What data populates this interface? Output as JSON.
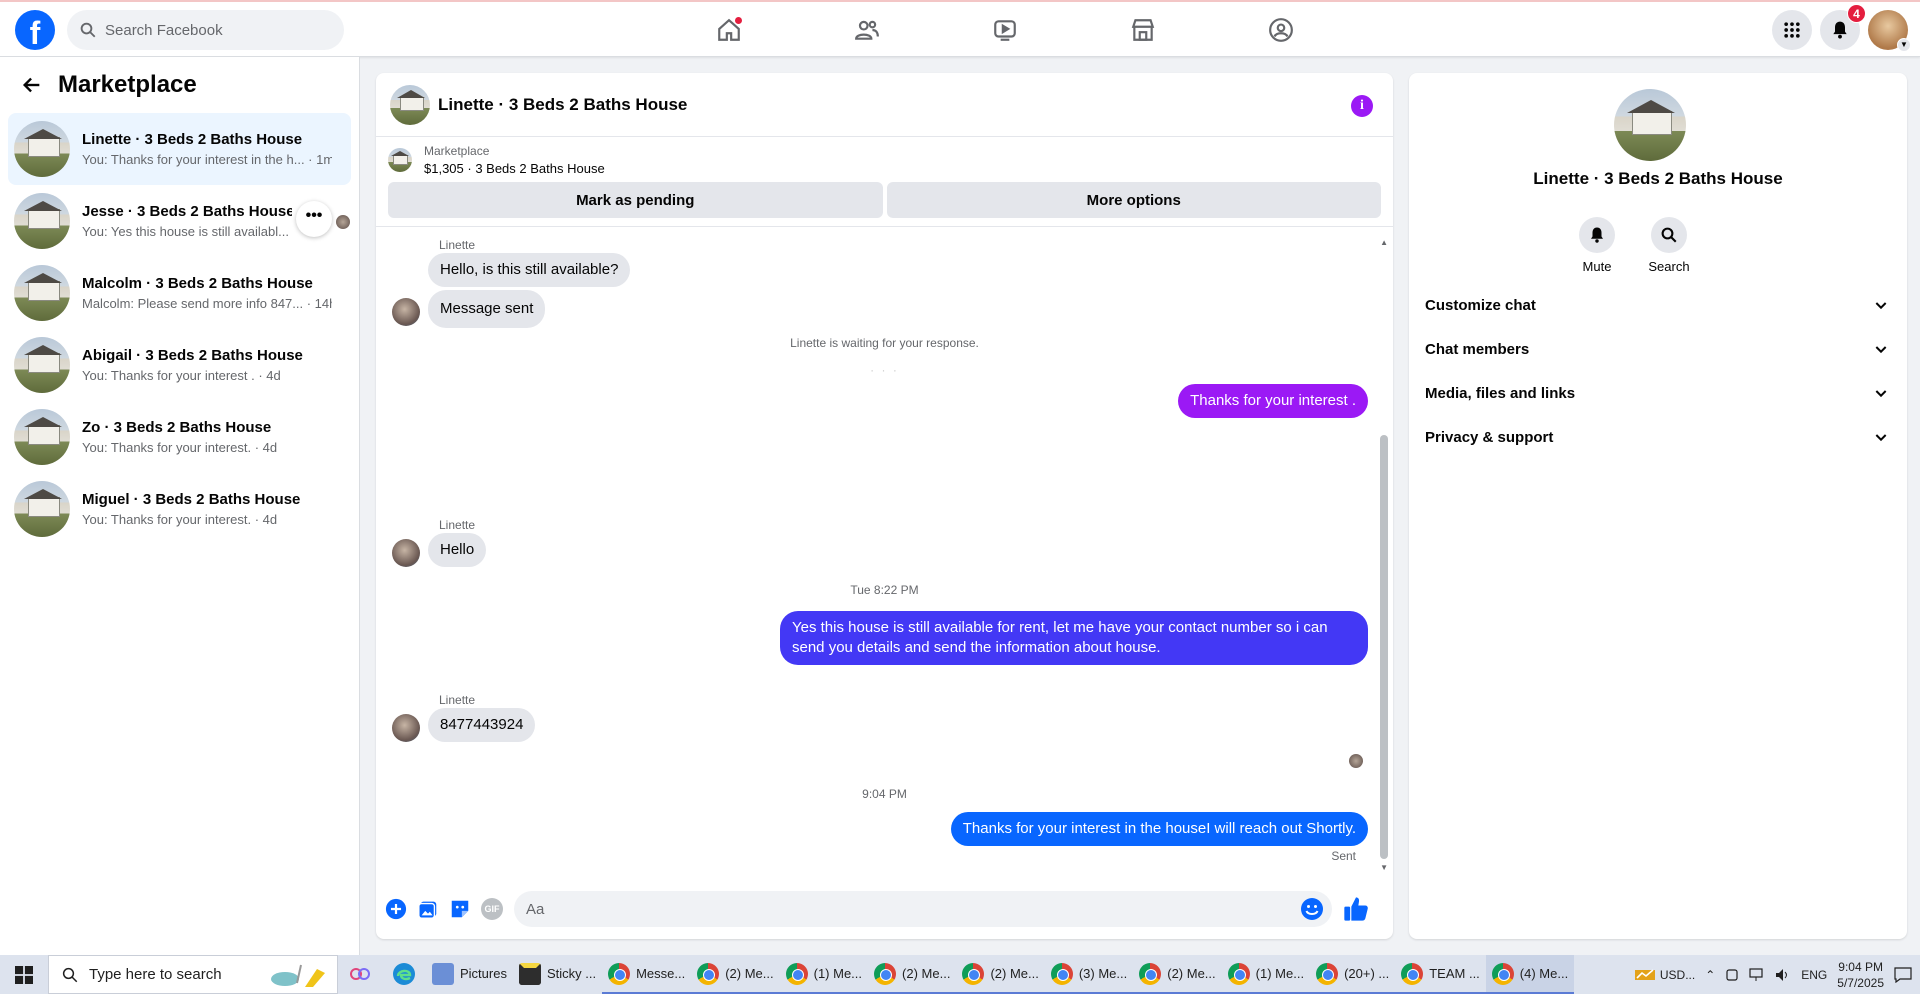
{
  "topbar": {
    "logo_letter": "f",
    "search_placeholder": "Search Facebook",
    "nav_icons": [
      "home-icon",
      "friends-icon",
      "video-icon",
      "marketplace-icon",
      "groups-icon"
    ],
    "notifications_badge": "4"
  },
  "sidebar": {
    "title": "Marketplace",
    "conversations": [
      {
        "name": "Linette · 3 Beds 2 Baths House",
        "preview": "You: Thanks for your interest in the h... · 1m",
        "active": true
      },
      {
        "name": "Jesse · 3 Beds 2 Baths House",
        "preview": "You: Yes this house is still availabl...",
        "active": false
      },
      {
        "name": "Malcolm · 3 Beds 2 Baths House",
        "preview": "Malcolm: Please send more info 847... · 14h",
        "active": false
      },
      {
        "name": "Abigail · 3 Beds 2 Baths House",
        "preview": "You: Thanks for your interest . · 4d",
        "active": false
      },
      {
        "name": "Zo · 3 Beds 2 Baths House",
        "preview": "You: Thanks for your interest. · 4d",
        "active": false
      },
      {
        "name": "Miguel · 3 Beds 2 Baths House",
        "preview": "You: Thanks for your interest. · 4d",
        "active": false
      }
    ],
    "more_button": "•••"
  },
  "chat": {
    "title": "Linette · 3 Beds 2 Baths House",
    "info_label": "i",
    "listing_label": "Marketplace",
    "listing_title": "$1,305 · 3 Beds 2 Baths House",
    "mark_pending": "Mark as pending",
    "more_options": "More options",
    "messages": {
      "sender1": "Linette",
      "m1": "Hello, is this still available?",
      "m2": "Message sent",
      "system": "Linette is waiting for your response.",
      "m3": "Thanks for your interest .",
      "sender2": "Linette",
      "m4": "Hello",
      "ts1": "Tue 8:22 PM",
      "m5_line1": "Yes this house is still available for rent, let me have your contact number so i can",
      "m5_line2": "send you details and send the information about house.",
      "sender3": "Linette",
      "m6": "8477443924",
      "ts2": "9:04 PM",
      "m7": "Thanks for your interest in the houseI will reach out Shortly.",
      "sent": "Sent"
    },
    "composer_placeholder": "Aa",
    "gif_label": "GIF",
    "colors": {
      "purple": "#9b19f5",
      "violet": "#6e2ff0",
      "indigo": "#4338f5",
      "blue": "#0866ff"
    }
  },
  "rpanel": {
    "name": "Linette · 3 Beds 2 Baths House",
    "mute": "Mute",
    "search": "Search",
    "rows": [
      "Customize chat",
      "Chat members",
      "Media, files and links",
      "Privacy & support"
    ]
  },
  "taskbar": {
    "search_placeholder": "Type here to search",
    "items": [
      {
        "label": "Pictures",
        "icon": "folder-icon"
      },
      {
        "label": "Sticky ...",
        "icon": "sticky-notes-icon"
      },
      {
        "label": "Messe...",
        "icon": "chrome-icon"
      },
      {
        "label": "(2) Me...",
        "icon": "chrome-icon"
      },
      {
        "label": "(1) Me...",
        "icon": "chrome-icon"
      },
      {
        "label": "(2) Me...",
        "icon": "chrome-icon"
      },
      {
        "label": "(2) Me...",
        "icon": "chrome-icon"
      },
      {
        "label": "(3) Me...",
        "icon": "chrome-icon"
      },
      {
        "label": "(2) Me...",
        "icon": "chrome-icon"
      },
      {
        "label": "(1) Me...",
        "icon": "chrome-icon"
      },
      {
        "label": "(20+) ...",
        "icon": "chrome-icon"
      },
      {
        "label": "TEAM ...",
        "icon": "chrome-icon"
      },
      {
        "label": "(4) Me...",
        "icon": "chrome-icon"
      }
    ],
    "currency": "USD...",
    "lang": "ENG",
    "time": "9:04 PM",
    "date": "5/7/2025"
  }
}
